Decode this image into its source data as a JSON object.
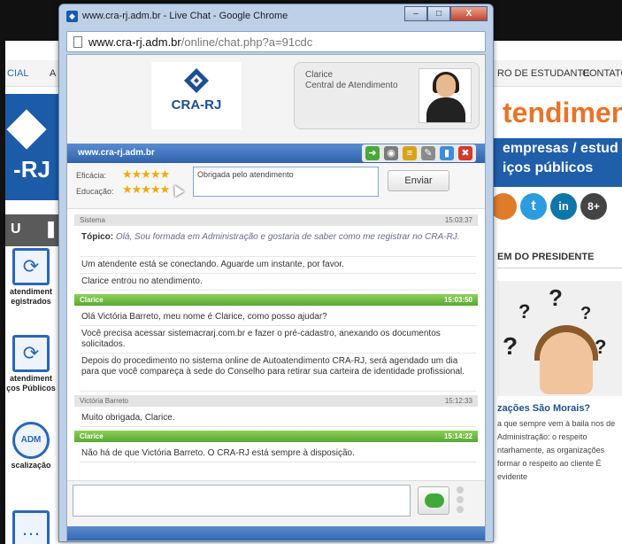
{
  "background_site": {
    "nav": {
      "left_item": "CIAL",
      "left_item2": "A",
      "right_item1": "RO DE ESTUDANTE",
      "right_item2": "CONTATO"
    },
    "logo_text": "-RJ",
    "dark_tab_text": "U",
    "side_items": [
      {
        "label": "atendiment egistrados",
        "icon": "refresh-icon"
      },
      {
        "label": "atendiment ços Públicos",
        "icon": "refresh-icon"
      },
      {
        "label": "scalização",
        "icon": "search-icon",
        "badge": "ADM"
      }
    ],
    "banner": {
      "headline": "tendimen",
      "line1": "empresas / estud",
      "line2": "iços públicos"
    },
    "social": [
      "t",
      "in",
      "8+"
    ],
    "news": {
      "header": "EM DO PRESIDENTE",
      "title": "zações São Morais?",
      "body": "a que sempre vem à baila nos de Administração: o respeito ntarhamente, as organizações formar o respeito ao cliente É evidente"
    }
  },
  "window": {
    "title": "www.cra-rj.adm.br - Live Chat - Google Chrome",
    "url_host": "www.cra-rj.adm.br",
    "url_path": "/online/chat.php?a=91cdc",
    "buttons": {
      "minimize": "–",
      "maximize": "□",
      "close": "X"
    }
  },
  "chat": {
    "logo_text": "CRA-RJ",
    "agent": {
      "name": "Clarice",
      "role": "Central de Atendimento"
    },
    "site_label": "www.cra-rj.adm.br",
    "tools": [
      {
        "icon": "arrow-icon",
        "glyph": "➜",
        "color": "#4aa83a"
      },
      {
        "icon": "sound-icon",
        "glyph": "◉",
        "color": "#7a7a7a"
      },
      {
        "icon": "print-icon",
        "glyph": "≡",
        "color": "#d9a21a"
      },
      {
        "icon": "edit-icon",
        "glyph": "✎",
        "color": "#8a8a8a"
      },
      {
        "icon": "chart-icon",
        "glyph": "▮",
        "color": "#3c8ed8"
      },
      {
        "icon": "exit-icon",
        "glyph": "✖",
        "color": "#d23a2a"
      }
    ],
    "rating": {
      "efficiency_label": "Eficácia:",
      "education_label": "Educação:",
      "efficiency_stars": "★★★★★",
      "education_stars": "★★★★★",
      "comment": "Obrigada pelo atendimento",
      "send_label": "Enviar"
    },
    "messages": [
      {
        "kind": "header-grey",
        "who": "Sistema",
        "time": "15:03:37"
      },
      {
        "kind": "line",
        "label": "Tópico:",
        "text": " Olá, Sou formada em Administração e gostaria de saber como me registrar no CRA-RJ."
      },
      {
        "kind": "line",
        "text": "Um atendente está se conectando. Aguarde um instante, por favor."
      },
      {
        "kind": "line",
        "text": "Clarice entrou no atendimento."
      },
      {
        "kind": "header-green",
        "who": "Clarice",
        "time": "15:03:50"
      },
      {
        "kind": "line",
        "text": "Olá Victória Barreto, meu nome é Clarice, como posso ajudar?"
      },
      {
        "kind": "line",
        "text": "Você precisa acessar sistemacrarj.com.br e fazer o pré-cadastro, anexando os documentos solicitados."
      },
      {
        "kind": "line",
        "text": "Depois do procedimento no sistema online de Autoatendimento CRA-RJ, será agendado um dia para que você compareça à sede do Conselho para retirar sua carteira de identidade profissional."
      },
      {
        "kind": "header-grey",
        "who": "Victória Barreto",
        "time": "15:12:33"
      },
      {
        "kind": "line",
        "text": "Muito obrigada, Clarice."
      },
      {
        "kind": "header-green",
        "who": "Clarice",
        "time": "15:14:22"
      },
      {
        "kind": "line",
        "text": "Não há de que Victória Barreto. O CRA-RJ está sempre à disposição."
      }
    ],
    "input_value": ""
  }
}
